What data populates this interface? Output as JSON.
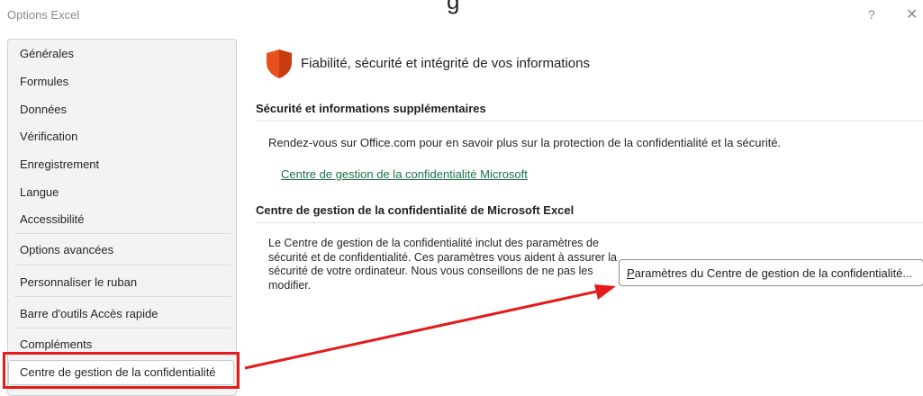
{
  "window": {
    "title": "Options Excel",
    "cut_heading": "g",
    "help_glyph": "?",
    "close_glyph": "✕"
  },
  "sidebar": {
    "items": [
      {
        "label": "Générales"
      },
      {
        "label": "Formules"
      },
      {
        "label": "Données"
      },
      {
        "label": "Vérification"
      },
      {
        "label": "Enregistrement"
      },
      {
        "label": "Langue"
      },
      {
        "label": "Accessibilité"
      },
      {
        "label": "Options avancées"
      },
      {
        "label": "Personnaliser le ruban"
      },
      {
        "label": "Barre d'outils Accès rapide"
      },
      {
        "label": "Compléments"
      },
      {
        "label": "Centre de gestion de la confidentialité",
        "selected": true
      }
    ]
  },
  "main": {
    "icon": "shield-icon",
    "title": "Fiabilité, sécurité et intégrité de vos informations",
    "section1": {
      "heading": "Sécurité et informations supplémentaires",
      "text": "Rendez-vous sur Office.com pour en savoir plus sur la protection de la confidentialité et la sécurité.",
      "link": "Centre de gestion de la confidentialité Microsoft"
    },
    "section2": {
      "heading": "Centre de gestion de la confidentialité de Microsoft Excel",
      "paragraph": "Le Centre de gestion de la confidentialité inclut des paramètres de sécurité et de confidentialité. Ces paramètres vous aident à assurer la sécurité de votre ordinateur. Nous vous conseillons de ne pas les modifier.",
      "button_access_key": "P",
      "button_rest": "aramètres du Centre de gestion de la confidentialité..."
    }
  },
  "colors": {
    "annotation_red": "#e31b1b",
    "link_green": "#1e7145",
    "shield_orange": "#e8501c"
  }
}
